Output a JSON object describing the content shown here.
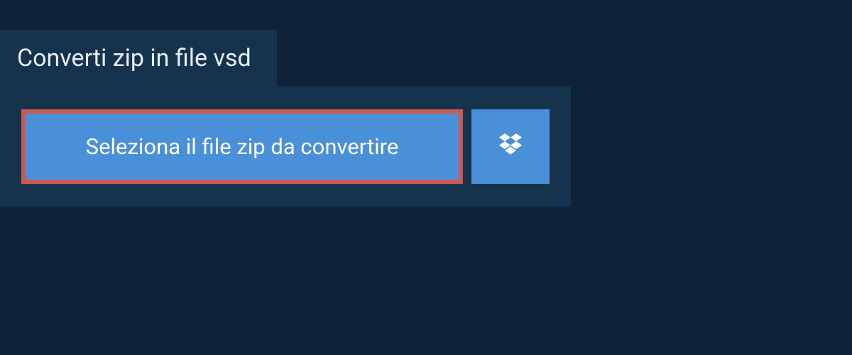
{
  "tab": {
    "title": "Converti zip in file vsd"
  },
  "actions": {
    "select_file_label": "Seleziona il file zip da convertire"
  },
  "colors": {
    "page_bg": "#0e2338",
    "panel_bg": "#16334d",
    "button_bg": "#4a90d9",
    "button_border": "#cc5a52",
    "text_light": "#ffffff"
  },
  "icons": {
    "dropbox": "dropbox-icon"
  }
}
